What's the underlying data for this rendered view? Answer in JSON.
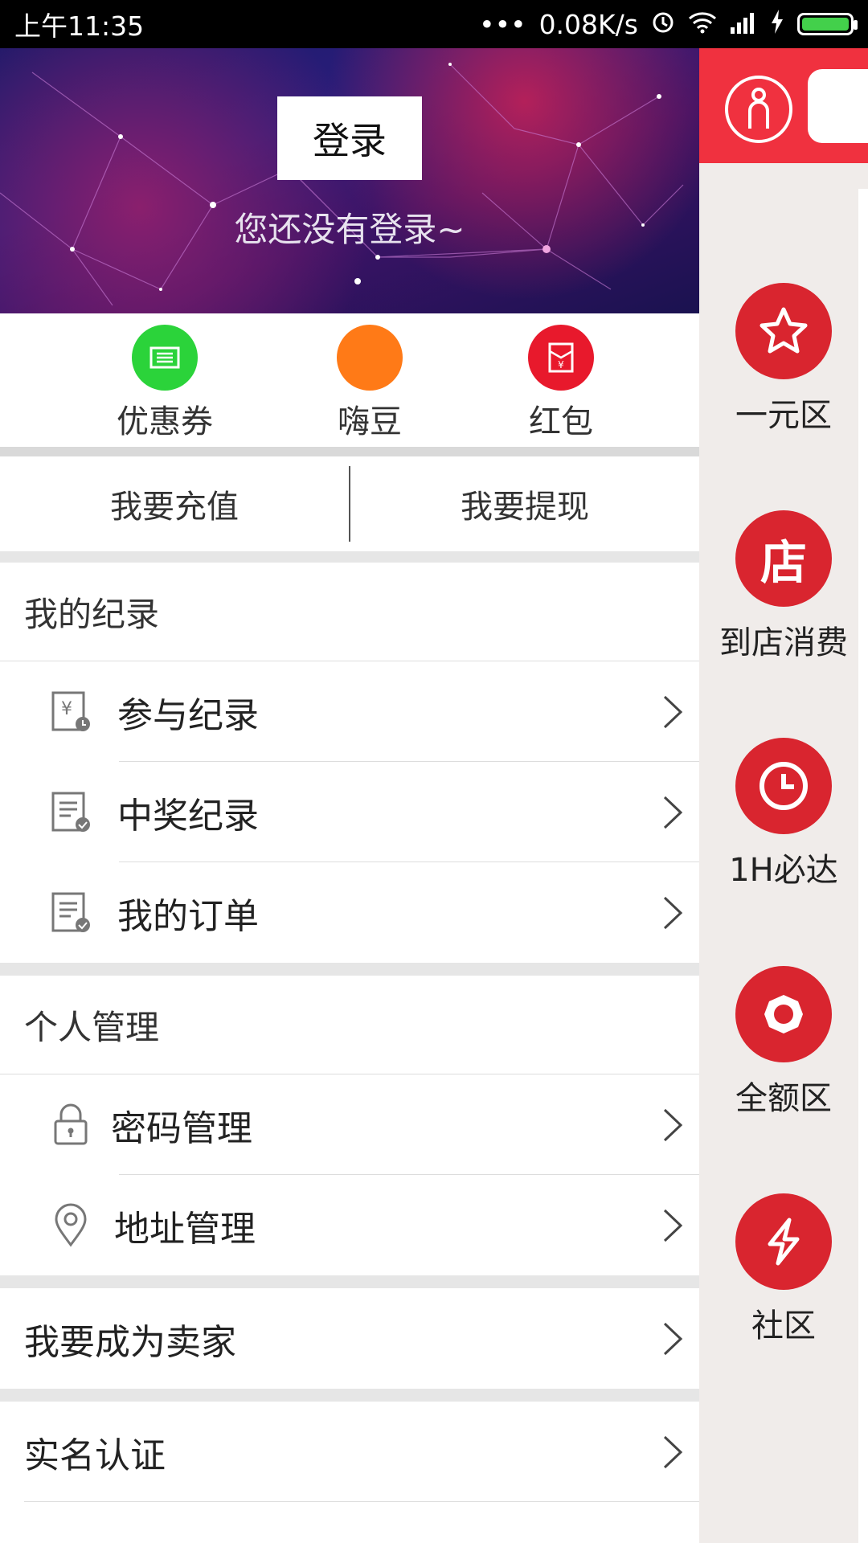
{
  "status_bar": {
    "time": "上午11:35",
    "network_speed": "0.08K/s",
    "battery_color": "#43d04b"
  },
  "drawer": {
    "login_button": "登录",
    "login_hint": "您还没有登录~",
    "quick_items": [
      {
        "label": "优惠券",
        "icon": "coupon-icon",
        "color": "#2bd33a"
      },
      {
        "label": "嗨豆",
        "icon": "bean-icon",
        "color": "#ff7a17"
      },
      {
        "label": "红包",
        "icon": "red-packet-icon",
        "color": "#e8192c"
      }
    ],
    "recharge": "我要充值",
    "withdraw": "我要提现",
    "records_title": "我的纪录",
    "records": [
      {
        "label": "参与纪录",
        "icon": "participation-record-icon"
      },
      {
        "label": "中奖纪录",
        "icon": "winning-record-icon"
      },
      {
        "label": "我的订单",
        "icon": "order-icon"
      }
    ],
    "personal_title": "个人管理",
    "personal": [
      {
        "label": "密码管理",
        "icon": "lock-icon"
      },
      {
        "label": "地址管理",
        "icon": "location-pin-icon"
      }
    ],
    "become_seller": "我要成为卖家",
    "real_name": "实名认证"
  },
  "right_panel": {
    "accent": "#f0313f",
    "categories": [
      {
        "label": "一元区",
        "icon": "star-icon"
      },
      {
        "label": "到店消费",
        "icon": "store-icon",
        "icon_text": "店"
      },
      {
        "label": "1H必达",
        "icon": "clock-icon"
      },
      {
        "label": "全额区",
        "icon": "full-amount-icon"
      },
      {
        "label": "社区",
        "icon": "lightning-icon"
      }
    ]
  }
}
